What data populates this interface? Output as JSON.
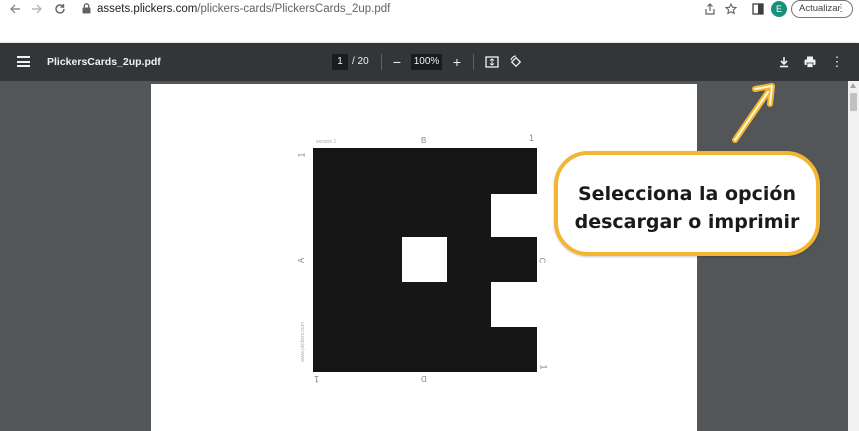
{
  "browser": {
    "back_icon": "arrow-left-icon",
    "forward_icon": "arrow-right-icon",
    "reload_icon": "reload-icon",
    "url_host": "assets.plickers.com",
    "url_path": "/plickers-cards/PlickersCards_2up.pdf",
    "avatar_letter": "E",
    "update_label": "Actualizar",
    "update_menu_glyph": "⋮"
  },
  "pdf_toolbar": {
    "title": "PlickersCards_2up.pdf",
    "current_page": "1",
    "total_pages": "/ 20",
    "zoom_out": "−",
    "zoom_level": "100%",
    "zoom_in": "+",
    "more_glyph": "⋮"
  },
  "card": {
    "version_label": "version 1",
    "top_letter": "B",
    "left_letter": "A",
    "right_letter": "C",
    "bottom_letter": "D",
    "corner_number": "1",
    "watermark": "www.plickers.com"
  },
  "callout": {
    "line1": "Selecciona la opción",
    "line2": "descargar o imprimir",
    "border_color": "#f2b632"
  }
}
